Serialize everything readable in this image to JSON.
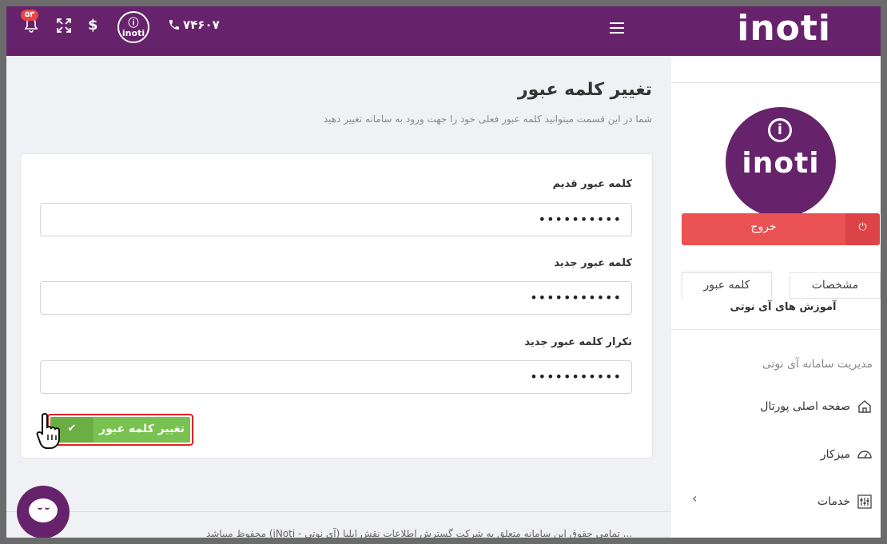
{
  "header": {
    "brand": "inoti",
    "phone": "۷۴۶۰۷",
    "logo_text": "inoti",
    "currency_symbol": "$",
    "notification_count": "۵۳"
  },
  "sidebar": {
    "avatar_text": "inoti",
    "logout_label": "خروج",
    "tabs": [
      {
        "label": "مشخصات"
      },
      {
        "label": "کلمه عبور"
      }
    ],
    "learn_label": "آموزش های آی نوتی",
    "section_title": "مدیریت سامانه آی نوتی",
    "items": [
      {
        "label": "صفحه اصلی پورتال"
      },
      {
        "label": "میزکار"
      },
      {
        "label": "خدمات"
      }
    ]
  },
  "main": {
    "title": "تغییر کلمه عبور",
    "subtitle": "شما در این قسمت میتوانید کلمه عبور فعلی خود را جهت ورود به سامانه تغییر دهید",
    "fields": [
      {
        "label": "کلمه عبور قدیم",
        "value": "••••••••••"
      },
      {
        "label": "کلمه عبور جدید",
        "value": "•••••••••••"
      },
      {
        "label": "تکرار کلمه عبور جدید",
        "value": "•••••••••••"
      }
    ],
    "submit_label": "تغییر کلمه عبور"
  },
  "footer": {
    "text": "... تمامی حقوق این سامانه متعلق به شرکت گسترش اطلاعات نقش ایلیا (آی نوتی - iNoti) محفوظ میباشد"
  },
  "colors": {
    "brand": "#66226b",
    "logout": "#ea5254",
    "submit": "#79c150",
    "highlight": "#e21f26"
  }
}
